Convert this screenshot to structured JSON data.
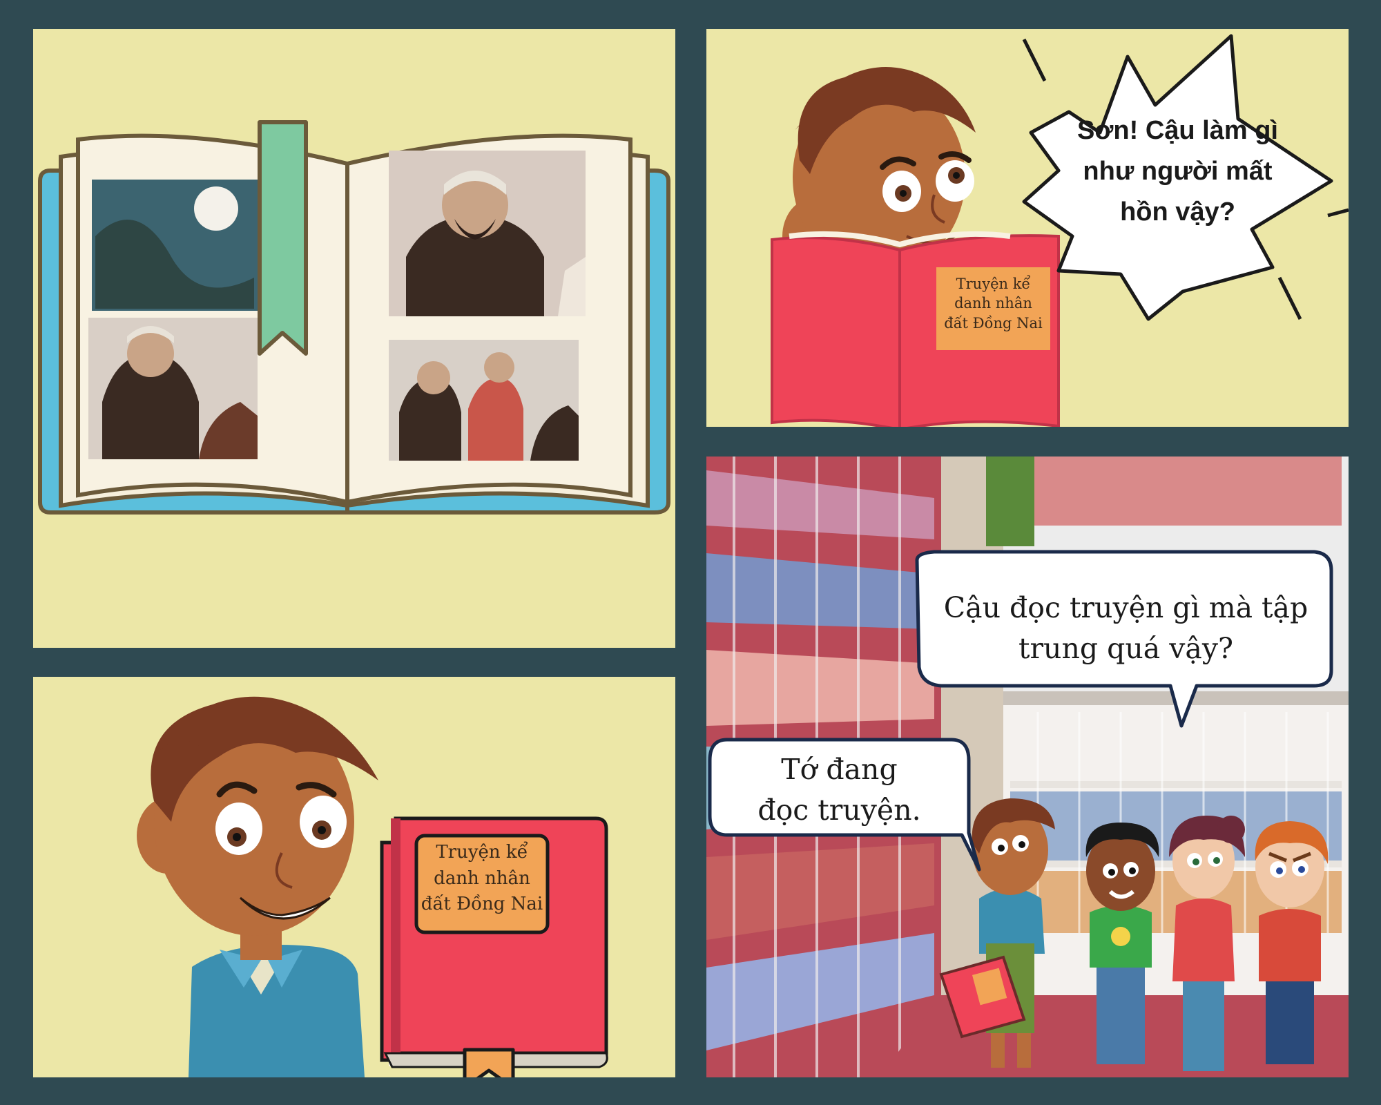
{
  "panel2": {
    "speech": [
      "Sơn! Cậu làm gì",
      "như người mất",
      "hồn vậy?"
    ],
    "book_cover": [
      "Truyện kể",
      "danh nhân",
      "đất Đồng Nai"
    ]
  },
  "panel3": {
    "book_cover": [
      "Truyện kể",
      "danh nhân",
      "đất Đồng Nai"
    ]
  },
  "panel4": {
    "speech_friend": [
      "Cậu đọc truyện gì mà tập",
      "trung quá vậy?"
    ],
    "speech_boy": [
      "Tớ đang",
      "đọc truyện."
    ]
  },
  "colors": {
    "background": "#2f4a52",
    "panel": "#ece7a7",
    "book_red": "#ef4458",
    "label_orange": "#f2a456",
    "skin": "#b86d3c",
    "hair": "#7a3a22"
  }
}
